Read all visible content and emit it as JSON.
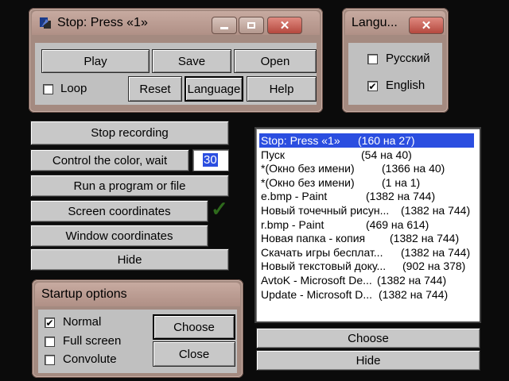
{
  "main_window": {
    "title": "Stop: Press «1»",
    "buttons": {
      "play": "Play",
      "save": "Save",
      "open": "Open",
      "reset": "Reset",
      "language": "Language",
      "help": "Help"
    },
    "loop_label": "Loop",
    "loop_checked": false
  },
  "language_window": {
    "title": "Langu...",
    "options": [
      {
        "label": "Русский",
        "checked": false
      },
      {
        "label": "English",
        "checked": true
      }
    ]
  },
  "controls": {
    "stop_recording": "Stop recording",
    "control_color": "Control the color, wait",
    "wait_value": "30",
    "run_program": "Run a program or file",
    "screen_coords": "Screen coordinates",
    "window_coords": "Window coordinates",
    "hide": "Hide",
    "checkmark": "✓"
  },
  "startup_window": {
    "title": "Startup options",
    "options": [
      {
        "label": "Normal",
        "checked": true
      },
      {
        "label": "Full screen",
        "checked": false
      },
      {
        "label": "Convolute",
        "checked": false
      }
    ],
    "choose": "Choose",
    "close": "Close"
  },
  "window_list": {
    "items": [
      {
        "name": "Stop: Press «1»",
        "size": "(160 на 27)",
        "selected": true
      },
      {
        "name": "Пуск",
        "size": "(54 на 40)"
      },
      {
        "name": "*(Окно без имени)",
        "size": "(1366 на 40)"
      },
      {
        "name": "*(Окно без имени)",
        "size": "(1 на 1)"
      },
      {
        "name": "e.bmp - Paint",
        "size": "(1382 на 744)"
      },
      {
        "name": "Новый точечный рисун...",
        "size": "(1382 на 744)"
      },
      {
        "name": "r.bmp - Paint",
        "size": "(469 на 614)"
      },
      {
        "name": "Новая папка - копия",
        "size": "(1382 на 744)"
      },
      {
        "name": "Скачать игры бесплат...",
        "size": "(1382 на 744)"
      },
      {
        "name": "Новый текстовый доку...",
        "size": "(902 на 378)"
      },
      {
        "name": "AvtoK - Microsoft De...",
        "size": "(1382 на 744)"
      },
      {
        "name": "Update - Microsoft D...",
        "size": "(1382 на 744)"
      }
    ],
    "choose": "Choose",
    "hide": "Hide"
  }
}
